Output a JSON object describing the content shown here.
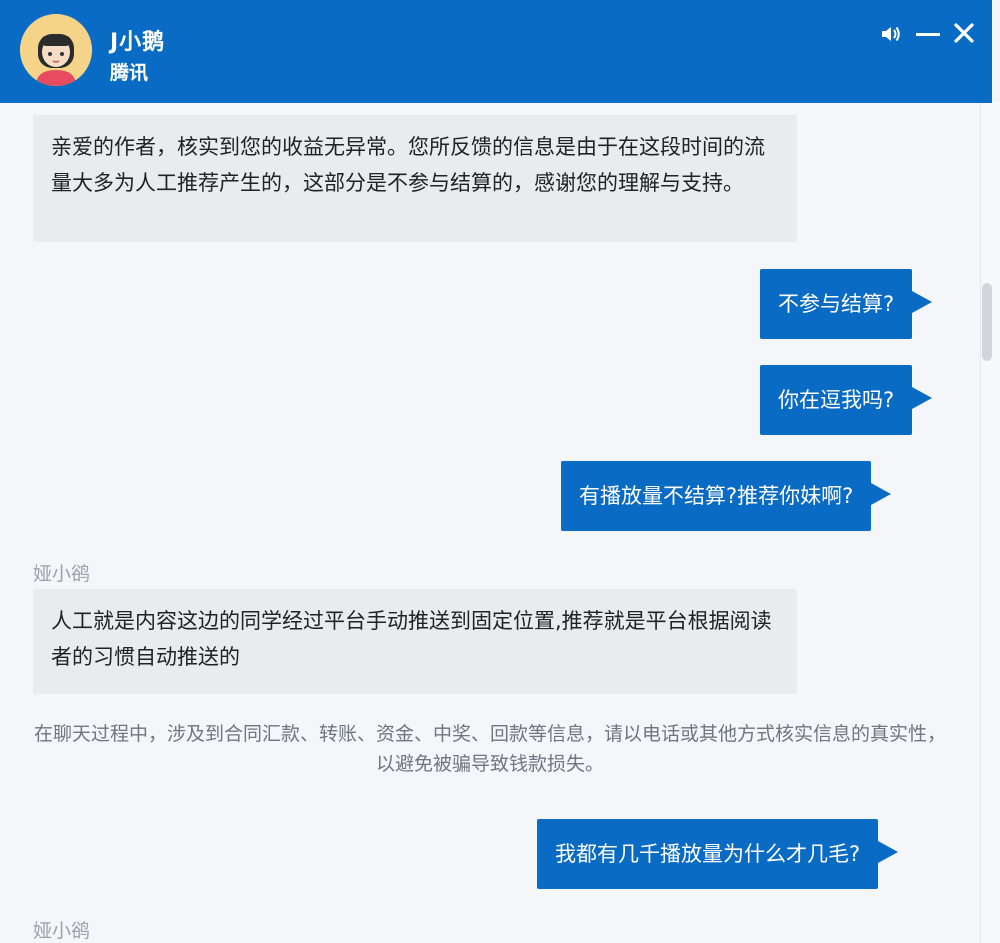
{
  "header": {
    "name": "J小鹅",
    "subtitle": "腾讯",
    "bg_color": "#0a6bc4",
    "icons": [
      "speaker-icon",
      "minimize-icon",
      "close-icon"
    ]
  },
  "messages": [
    {
      "type": "in",
      "text": "亲爱的作者，核实到您的收益无异常。您所反馈的信息是由于在这段时间的流量大多为人工推荐产生的，这部分是不参与结算的，感谢您的理解与支持。"
    },
    {
      "type": "out",
      "text": "不参与结算?"
    },
    {
      "type": "out",
      "text": "你在逗我吗?"
    },
    {
      "type": "out",
      "text": "有播放量不结算?推荐你妹啊?"
    },
    {
      "type": "sender",
      "text": "娅小鹆"
    },
    {
      "type": "in",
      "text": "人工就是内容这边的同学经过平台手动推送到固定位置,推荐就是平台根据阅读者的习惯自动推送的"
    },
    {
      "type": "notice",
      "text": "在聊天过程中，涉及到合同汇款、转账、资金、中奖、回款等信息，请以电话或其他方式核实信息的真实性，以避免被骗导致钱款损失。"
    },
    {
      "type": "out",
      "text": "我都有几千播放量为什么才几毛?"
    },
    {
      "type": "sender",
      "text": "娅小鹆"
    }
  ],
  "colors": {
    "outgoing_bubble": "#0a6bc4",
    "incoming_bubble": "#e9ebef",
    "chat_bg": "#f4f6f9"
  }
}
